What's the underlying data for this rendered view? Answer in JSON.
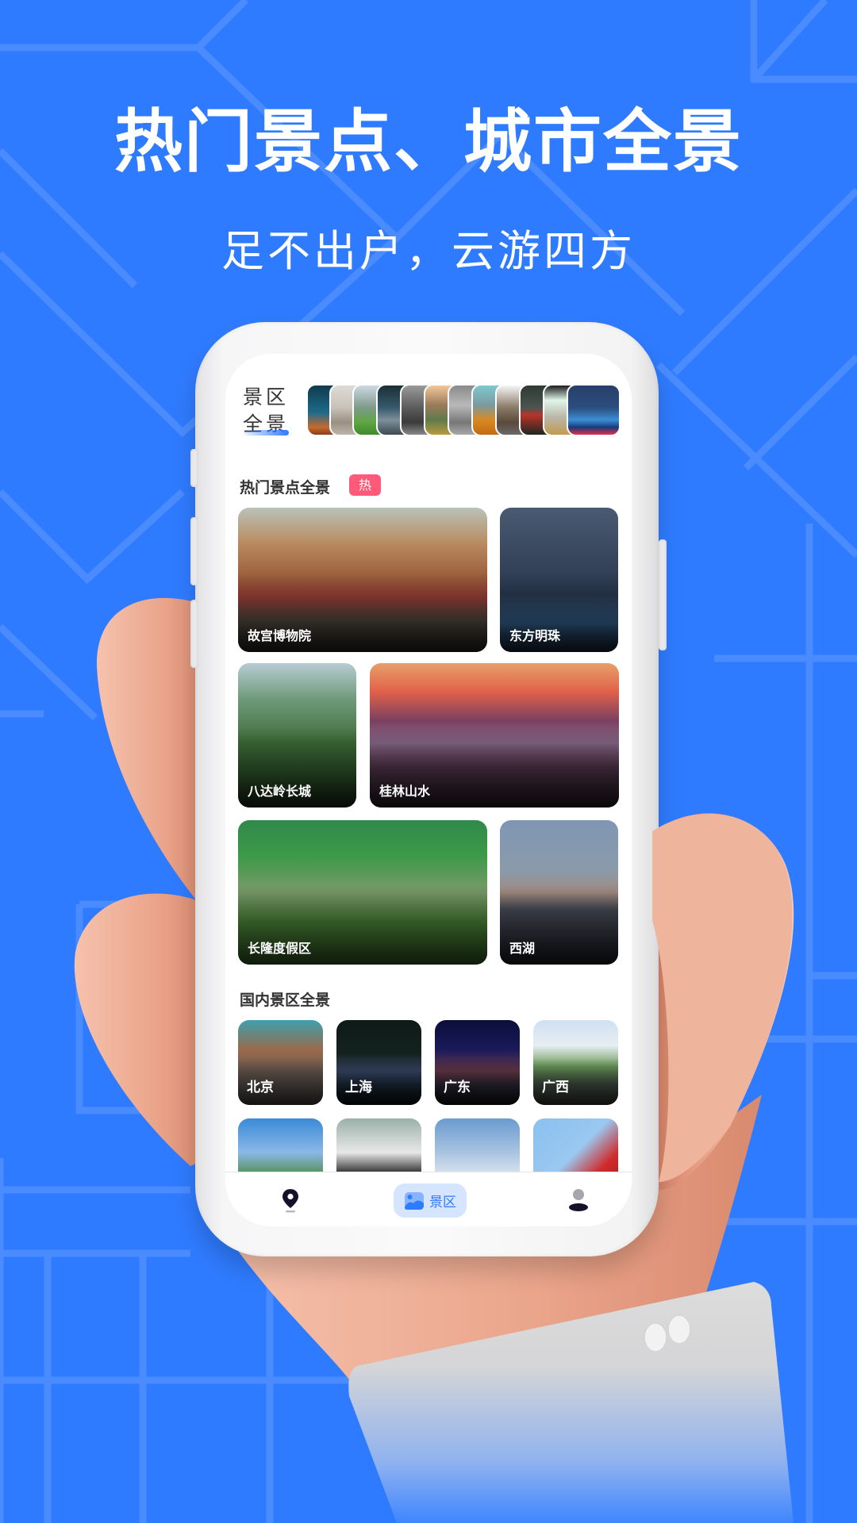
{
  "promo": {
    "headline": "热门景点、城市全景",
    "subheadline": "足不出户，云游四方",
    "background_color": "#2f7bff"
  },
  "app": {
    "brand": {
      "line1": "景区",
      "line2": "全景",
      "accent_color": "#2f7bff"
    },
    "thumbnail_strip": {
      "count": 12,
      "icon": "scenic-thumbnail-image"
    },
    "hot_section": {
      "title": "热门景点全景",
      "badge": "热",
      "badge_color": "#ff5a7a",
      "items": [
        {
          "label": "故宫博物院"
        },
        {
          "label": "东方明珠"
        },
        {
          "label": "八达岭长城"
        },
        {
          "label": "桂林山水"
        },
        {
          "label": "长隆度假区"
        },
        {
          "label": "西湖"
        }
      ]
    },
    "domestic_section": {
      "title": "国内景区全景",
      "items": [
        {
          "label": "北京"
        },
        {
          "label": "上海"
        },
        {
          "label": "广东"
        },
        {
          "label": "广西"
        },
        {
          "label": ""
        },
        {
          "label": ""
        },
        {
          "label": ""
        },
        {
          "label": ""
        }
      ]
    },
    "bottom_nav": {
      "items": [
        {
          "icon": "map-pin-icon",
          "label": "",
          "active": false
        },
        {
          "icon": "image-landscape-icon",
          "label": "景区",
          "active": true
        },
        {
          "icon": "user-icon",
          "label": "",
          "active": false
        }
      ]
    }
  }
}
